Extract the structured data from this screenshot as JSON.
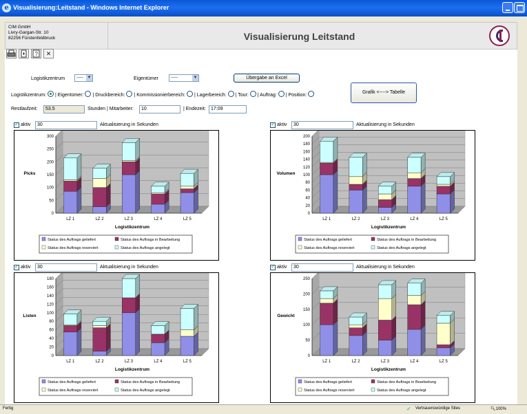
{
  "window": {
    "title": "Visualisierung:Leitstand - Windows Internet Explorer"
  },
  "header": {
    "company": [
      "CIM GmbH",
      "Livry-Gargan-Str. 10",
      "82256 Fürstenfeldbruck"
    ],
    "title": "Visualisierung Leitstand"
  },
  "toolbar": {
    "icons": [
      "printer-icon",
      "export-icon",
      "help-icon",
      "close-icon"
    ],
    "close_glyph": "✕"
  },
  "filters": {
    "logistikzentrum_label": "Logistikzentrum",
    "logistikzentrum_value": "-----",
    "eigentuemer_label": "Eigentümer",
    "eigentuemer_value": "-----",
    "excel_button": "Übergabe an Excel",
    "toggle_button": "Grafik <----> Tabelle"
  },
  "radios": {
    "items": [
      {
        "label": "Logistikzentrum:",
        "checked": true
      },
      {
        "label": "| Eigentümer:",
        "checked": false
      },
      {
        "label": "| Druckbereich:",
        "checked": false
      },
      {
        "label": "| Kommissionierbereich:",
        "checked": false
      },
      {
        "label": "| Lagerbereich:",
        "checked": false
      },
      {
        "label": "| Tour:",
        "checked": false
      },
      {
        "label": "| Auftrag:",
        "checked": false
      },
      {
        "label": "| Position:",
        "checked": false
      }
    ]
  },
  "info": {
    "restlaufzeit_label": "Restlaufzeit:",
    "restlaufzeit_value": "53.5",
    "stunden_label": "Stunden | Mitarbeiter:",
    "mitarbeiter_value": "10",
    "endezeit_label": "| Endezeit:",
    "endezeit_value": "17:09"
  },
  "panels": [
    {
      "aktiv_label": "aktiv",
      "interval": "30",
      "interval_label": "Aktualisierung in Sekunden"
    },
    {
      "aktiv_label": "aktiv",
      "interval": "30",
      "interval_label": "Aktualisierung in Sekunden"
    },
    {
      "aktiv_label": "aktiv",
      "interval": "30",
      "interval_label": "Aktualisierung in Sekunden"
    },
    {
      "aktiv_label": "aktiv",
      "interval": "30",
      "interval_label": "Aktualisierung in Sekunden"
    }
  ],
  "colors": {
    "geliefert": "#8f8fe8",
    "bearbeitung": "#993366",
    "reserviert": "#ffffcc",
    "angelegt": "#ccffff",
    "floor": "#c0c0c0",
    "wall": "#c0c0c0"
  },
  "legend_labels": [
    "Status des Auftrags geliefert",
    "Status des Auftrags in Bearbeitung",
    "Status des Auftrags reserviert",
    "Status des Auftrags angelegt"
  ],
  "chart_data": [
    {
      "type": "bar",
      "stacked": true,
      "ylabel": "Picks",
      "xlabel": "Logistikzentrum",
      "categories": [
        "LZ 1",
        "LZ 2",
        "LZ 3",
        "LZ 4",
        "LZ 5"
      ],
      "ylim": [
        0,
        300
      ],
      "yticks": [
        0,
        50,
        100,
        150,
        200,
        250,
        300
      ],
      "series": [
        {
          "name": "Status des Auftrags geliefert",
          "values": [
            85,
            25,
            150,
            35,
            80
          ]
        },
        {
          "name": "Status des Auftrags in Bearbeitung",
          "values": [
            40,
            75,
            50,
            40,
            15
          ]
        },
        {
          "name": "Status des Auftrags reserviert",
          "values": [
            5,
            35,
            5,
            5,
            10
          ]
        },
        {
          "name": "Status des Auftrags angelegt",
          "values": [
            85,
            40,
            70,
            25,
            50
          ]
        }
      ]
    },
    {
      "type": "bar",
      "stacked": true,
      "ylabel": "Volumen",
      "xlabel": "Logistikzentrum",
      "categories": [
        "LZ 1",
        "LZ 2",
        "LZ 3",
        "LZ 4",
        "LZ 5"
      ],
      "ylim": [
        0,
        200
      ],
      "yticks": [
        0,
        20,
        40,
        60,
        80,
        100,
        120,
        140,
        160,
        180,
        200
      ],
      "series": [
        {
          "name": "Status des Auftrags geliefert",
          "values": [
            100,
            60,
            15,
            70,
            50
          ]
        },
        {
          "name": "Status des Auftrags in Bearbeitung",
          "values": [
            30,
            15,
            20,
            20,
            20
          ]
        },
        {
          "name": "Status des Auftrags reserviert",
          "values": [
            2,
            20,
            15,
            15,
            5
          ]
        },
        {
          "name": "Status des Auftrags angelegt",
          "values": [
            55,
            50,
            20,
            40,
            20
          ]
        }
      ]
    },
    {
      "type": "bar",
      "stacked": true,
      "ylabel": "Listen",
      "xlabel": "Logistikzentrum",
      "categories": [
        "LZ 1",
        "LZ 2",
        "LZ 3",
        "LZ 4",
        "LZ 5"
      ],
      "ylim": [
        0,
        180
      ],
      "yticks": [
        0,
        20,
        40,
        60,
        80,
        100,
        120,
        140,
        160,
        180
      ],
      "series": [
        {
          "name": "Status des Auftrags geliefert",
          "values": [
            55,
            10,
            100,
            30,
            45
          ]
        },
        {
          "name": "Status des Auftrags in Bearbeitung",
          "values": [
            15,
            55,
            35,
            20,
            0
          ]
        },
        {
          "name": "Status des Auftrags reserviert",
          "values": [
            2,
            5,
            0,
            0,
            15
          ]
        },
        {
          "name": "Status des Auftrags angelegt",
          "values": [
            25,
            10,
            45,
            20,
            50
          ]
        }
      ]
    },
    {
      "type": "bar",
      "stacked": true,
      "ylabel": "Gewicht",
      "xlabel": "Logistikzentrum",
      "categories": [
        "LZ 1",
        "LZ 2",
        "LZ 3",
        "LZ 4",
        "LZ 5"
      ],
      "ylim": [
        0,
        250
      ],
      "yticks": [
        0,
        50,
        100,
        150,
        200,
        250
      ],
      "series": [
        {
          "name": "Status des Auftrags geliefert",
          "values": [
            100,
            65,
            50,
            85,
            25
          ]
        },
        {
          "name": "Status des Auftrags in Bearbeitung",
          "values": [
            70,
            25,
            65,
            80,
            10
          ]
        },
        {
          "name": "Status des Auftrags reserviert",
          "values": [
            15,
            10,
            70,
            30,
            70
          ]
        },
        {
          "name": "Status des Auftrags angelegt",
          "values": [
            25,
            25,
            45,
            40,
            25
          ]
        }
      ]
    }
  ],
  "statusbar": {
    "left": "Fertig",
    "zone": "Vertrauenswürdige Sites",
    "zoom": "100%"
  }
}
